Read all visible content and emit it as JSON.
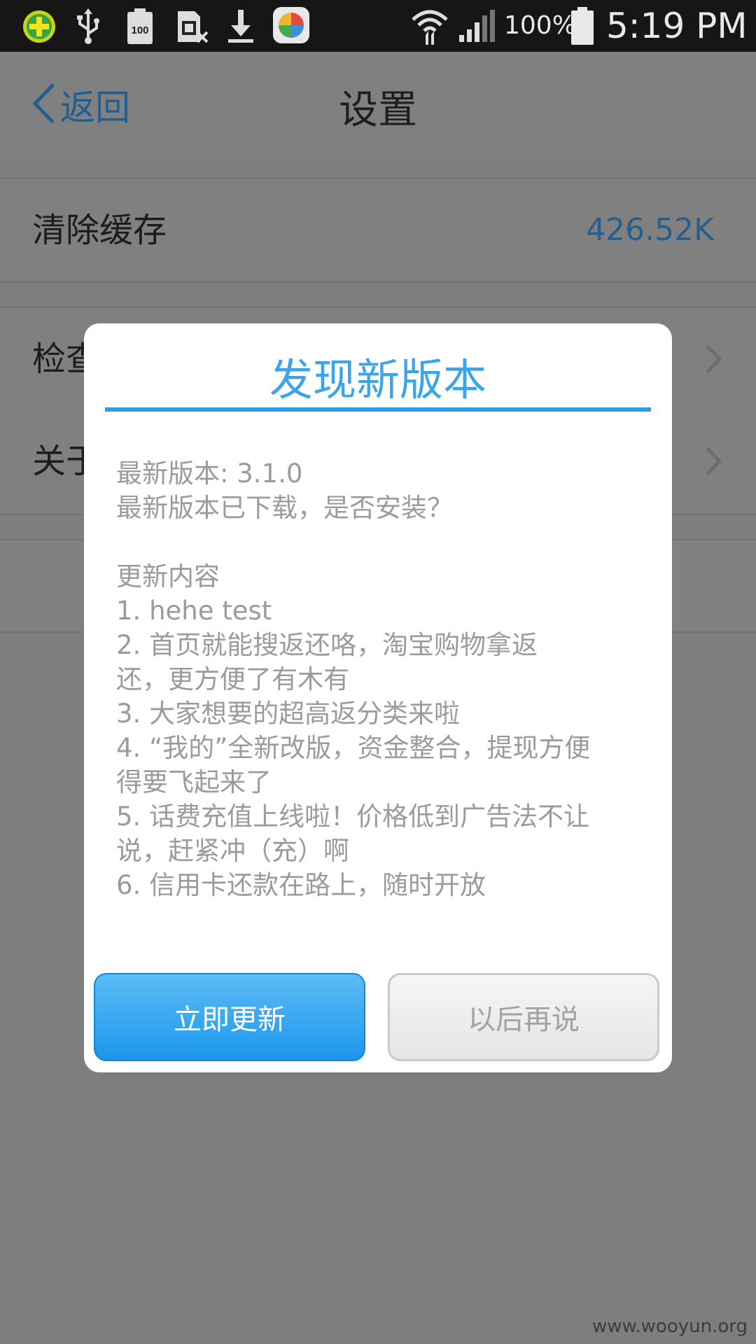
{
  "status_bar": {
    "battery_percent": "100%",
    "time": "5:19 PM",
    "notification_icons": [
      "security-plus-icon",
      "usb-icon",
      "battery-100-icon",
      "sim-off-icon",
      "download-icon",
      "app-store-icon"
    ]
  },
  "navbar": {
    "back_label": "返回",
    "title": "设置"
  },
  "settings": {
    "clear_cache_label": "清除缓存",
    "cache_size": "426.52K",
    "check_update_label": "检查",
    "about_label": "关于"
  },
  "dialog": {
    "title": "发现新版本",
    "lines": [
      "最新版本: 3.1.0",
      "最新版本已下载，是否安装？",
      "",
      "更新内容",
      "1. hehe test",
      "2. 首页就能搜返还咯，淘宝购物拿返",
      "还，更方便了有木有",
      "3. 大家想要的超高返分类来啦",
      "4. “我的”全新改版，资金整合，提现方便",
      "得要飞起来了",
      "5. 话费充值上线啦！价格低到广告法不让",
      "说，赶紧冲（充）啊",
      "6. 信用卡还款在路上，随时开放"
    ],
    "confirm_label": "立即更新",
    "cancel_label": "以后再说"
  },
  "watermark": "www.wooyun.org"
}
